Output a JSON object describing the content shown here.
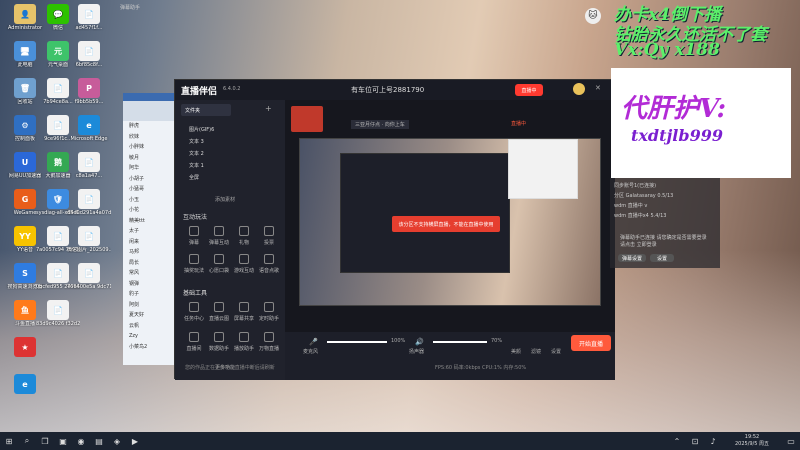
{
  "desktop": {
    "icons": [
      {
        "label": "Administrator",
        "glyph": "👤",
        "color": "#e6c36a"
      },
      {
        "label": "微信",
        "glyph": "💬",
        "color": "#2dc100"
      },
      {
        "label": "ad457f1f...",
        "glyph": "📄",
        "color": "#f2f2f2"
      },
      {
        "label": "此电脑",
        "glyph": "🖥",
        "color": "#4a90d9"
      },
      {
        "label": "元气桌面",
        "glyph": "元",
        "color": "#3ec36a"
      },
      {
        "label": "6bf85c8f...",
        "glyph": "📄",
        "color": "#f2f2f2"
      },
      {
        "label": "回收站",
        "glyph": "🗑",
        "color": "#6fa0cf"
      },
      {
        "label": "7b94ce8a...",
        "glyph": "📄",
        "color": "#f2f2f2"
      },
      {
        "label": "f9bb5b59...",
        "glyph": "P",
        "color": "#c75c9a"
      },
      {
        "label": "控制面板",
        "glyph": "⚙",
        "color": "#2f6fc2"
      },
      {
        "label": "9ce96f1c...",
        "glyph": "📄",
        "color": "#f2f2f2"
      },
      {
        "label": "Microsoft Edge",
        "glyph": "e",
        "color": "#1c8ad9"
      },
      {
        "label": "网易UU加速器",
        "glyph": "U",
        "color": "#2b68d8"
      },
      {
        "label": "大鹅加速器",
        "glyph": "鹅",
        "color": "#34a853"
      },
      {
        "label": "c8a1a47...",
        "glyph": "📄",
        "color": "#f2f2f2"
      },
      {
        "label": "WeGame",
        "glyph": "G",
        "color": "#e85d1a"
      },
      {
        "label": "sysdiag-all-x64-6.0...",
        "glyph": "🛡",
        "color": "#3d8be0"
      },
      {
        "label": "d5d0d291a4a07d3...",
        "glyph": "📄",
        "color": "#f2f2f2"
      },
      {
        "label": "YY语音",
        "glyph": "YY",
        "color": "#f7c300"
      },
      {
        "label": "7a0057c94 7b933df...",
        "glyph": "📄",
        "color": "#f2f2f2"
      },
      {
        "label": "微信图片_202509...",
        "glyph": "📄",
        "color": "#f2f2f2"
      },
      {
        "label": "搜狗高速浏览器",
        "glyph": "S",
        "color": "#2f7ce0"
      },
      {
        "label": "0bcfed955 247e5db...",
        "glyph": "📄",
        "color": "#f2f2f2"
      },
      {
        "label": "766400e5a 9dc71e5...",
        "glyph": "📄",
        "color": "#f2f2f2"
      },
      {
        "label": "斗鱼直播",
        "glyph": "鱼",
        "color": "#ff7a1a"
      },
      {
        "label": "83d9c4026 f32d270e...",
        "glyph": "📄",
        "color": "#f2f2f2"
      },
      {
        "label": "",
        "glyph": "★",
        "color": "#d33"
      },
      {
        "label": "",
        "glyph": "e",
        "color": "#1c8ad9"
      }
    ]
  },
  "overlay": {
    "line1": "办卡x4倒下播",
    "line2": "钻胎永久还活不了套",
    "line3": "Vx:Qy x188",
    "promo1": "代肝护V:",
    "promo2": "txdtjlb999"
  },
  "qq": {
    "items": [
      "胖虎",
      "欣妹",
      "小胖妹",
      "敏月",
      "阿华",
      "小胡子",
      "小猛哥",
      "小玉",
      "小花",
      "精美ttt",
      "太子",
      "闲来",
      "马邦",
      "局长",
      "常风",
      "钢弹",
      "豹子",
      "阿剑",
      "夏天好",
      "云帆",
      "Zzy",
      "小菜鸟2"
    ]
  },
  "app": {
    "title": "直播伴侣",
    "version": "6.4.0.2",
    "header_info": "有车位可上号2881790",
    "tabs": [
      "场景",
      "画布"
    ],
    "room_tag": "三亚月仔点 · 向你上车",
    "live_label": "直播中",
    "stats": "0",
    "scene_label": "文件夹",
    "sources": [
      "图片(GIF)6",
      "文本 3",
      "文本 2",
      "文本 1",
      "全屏"
    ],
    "source_badge": "添加素材",
    "section_interact": "互动玩法",
    "interact_tools": [
      "弹幕",
      "弹幕互动",
      "礼物",
      "投票",
      "连麦",
      "红包"
    ],
    "interact_tools2": [
      "抽奖玩法",
      "心愿口袋",
      "游戏互动",
      "语音点歌"
    ],
    "section_basic": "基础工具",
    "basic_tools": [
      "任务中心",
      "直播云图",
      "屏幕共享",
      "定时助手"
    ],
    "basic_tools2": [
      "直播间",
      "数据助手",
      "播放助手",
      "万物直播"
    ],
    "more": "更多功能",
    "warning": "该分区不支持横屏直播，不能在直播中使用",
    "mic_label": "麦克风",
    "mic_pct": "100%",
    "spk_label": "扬声器",
    "spk_pct": "70%",
    "bottom_tools": [
      "美颜",
      "滤镜",
      "设置"
    ],
    "start_button": "开始直播",
    "status_bar": "您的作品正在上传中 · 直播中断后请刷新",
    "status_stats": "FPS:60  码率:0kbps  CPU:1%  内存:50%"
  },
  "right_panel": {
    "lines": [
      "同步账号1(已连接)",
      "分区 Galatasaray 0.5/13",
      "wdm 直播中 v",
      "wdm 直播中x4 5.4/13"
    ],
    "notice": "弹幕助手已连接 请您确定是否需要登录 请点击 立即登录",
    "buttons": [
      "弹幕设置",
      "设置"
    ]
  },
  "taskbar": {
    "time": "19:52",
    "date": "2025/9/5 周五"
  }
}
